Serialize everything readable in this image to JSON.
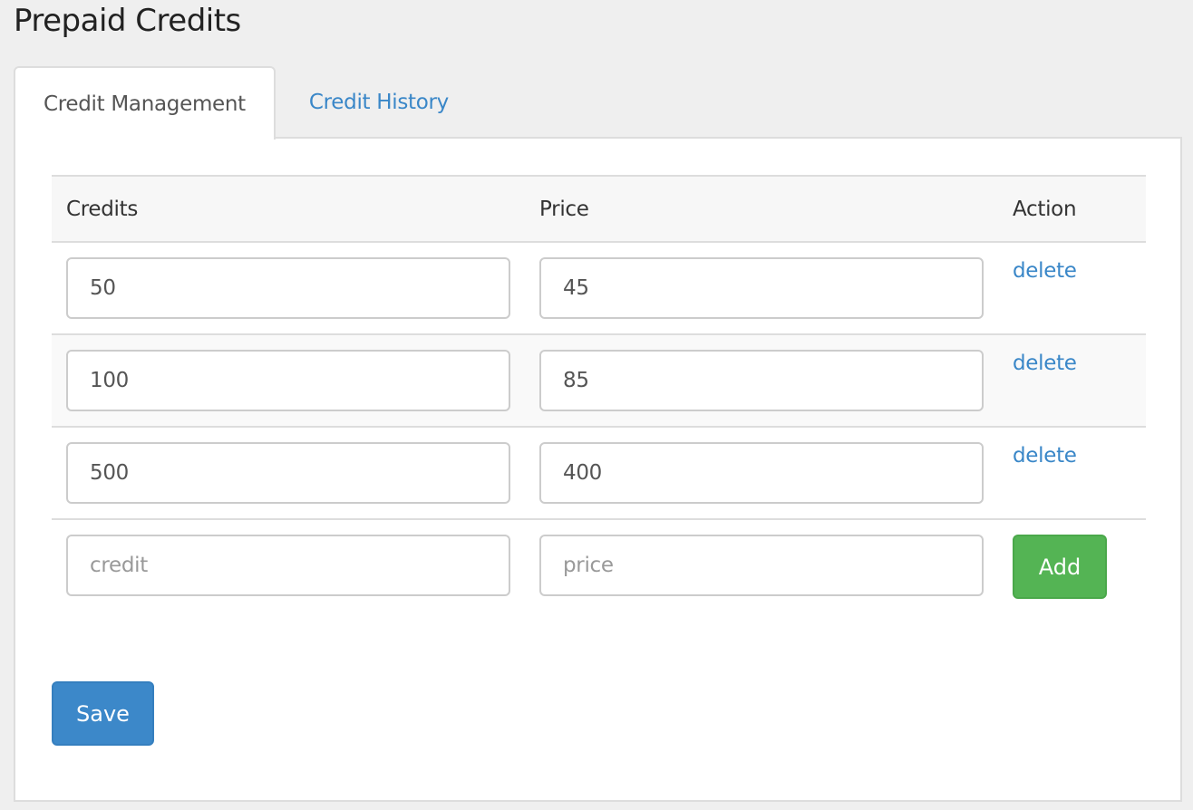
{
  "page": {
    "title": "Prepaid Credits"
  },
  "tabs": [
    {
      "label": "Credit Management",
      "active": true
    },
    {
      "label": "Credit History",
      "active": false
    }
  ],
  "table": {
    "headers": {
      "credits": "Credits",
      "price": "Price",
      "action": "Action"
    },
    "rows": [
      {
        "credits": "50",
        "price": "45",
        "action_label": "delete"
      },
      {
        "credits": "100",
        "price": "85",
        "action_label": "delete"
      },
      {
        "credits": "500",
        "price": "400",
        "action_label": "delete"
      }
    ],
    "new_row": {
      "credits_value": "",
      "credits_placeholder": "credit",
      "price_value": "",
      "price_placeholder": "price",
      "add_label": "Add"
    }
  },
  "actions": {
    "save_label": "Save"
  },
  "colors": {
    "link": "#3a87c8",
    "add_button": "#54b454",
    "save_button": "#3c88c9",
    "page_background": "#efefef"
  }
}
